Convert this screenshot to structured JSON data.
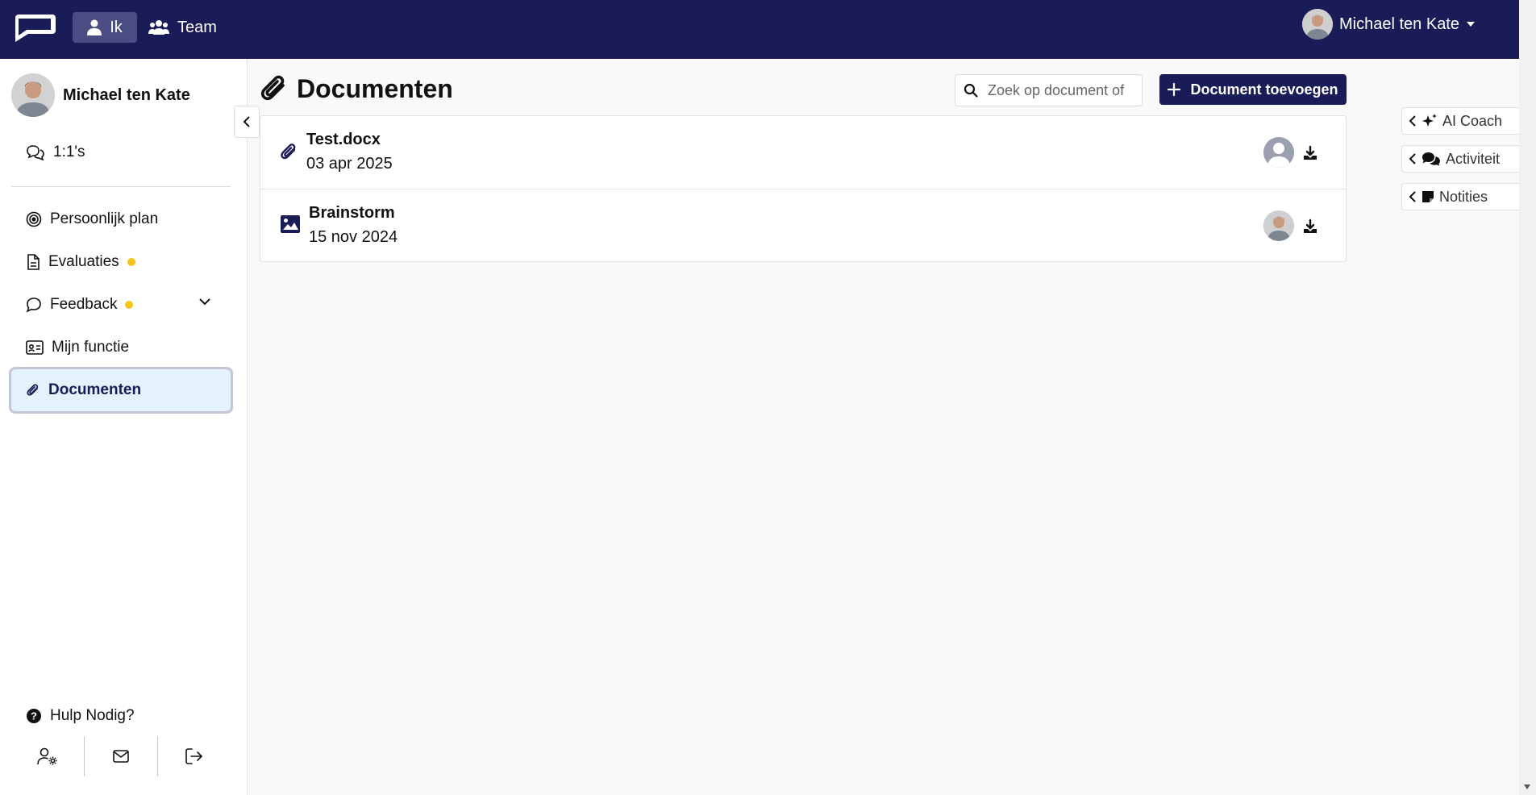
{
  "topbar": {
    "nav_ik": "Ik",
    "nav_team": "Team",
    "user_name": "Michael ten Kate"
  },
  "sidebar": {
    "user_name": "Michael ten Kate",
    "items": [
      {
        "label": "1:1's"
      },
      {
        "label": "Persoonlijk plan"
      },
      {
        "label": "Evaluaties"
      },
      {
        "label": "Feedback"
      },
      {
        "label": "Mijn functie"
      },
      {
        "label": "Documenten"
      }
    ],
    "help": "Hulp Nodig?"
  },
  "main": {
    "title": "Documenten",
    "search_placeholder": "Zoek op document of",
    "add_button": "Document toevoegen",
    "documents": [
      {
        "name": "Test.docx",
        "date": "03 apr 2025",
        "icon": "paperclip-icon"
      },
      {
        "name": "Brainstorm",
        "date": "15 nov 2024",
        "icon": "image-icon"
      }
    ]
  },
  "right_panel": {
    "tabs": [
      {
        "label": "AI Coach"
      },
      {
        "label": "Activiteit"
      },
      {
        "label": "Notities"
      }
    ]
  },
  "colors": {
    "brand": "#1a1c57",
    "active_bg": "#e3f2fd",
    "badge": "#f5c518"
  }
}
